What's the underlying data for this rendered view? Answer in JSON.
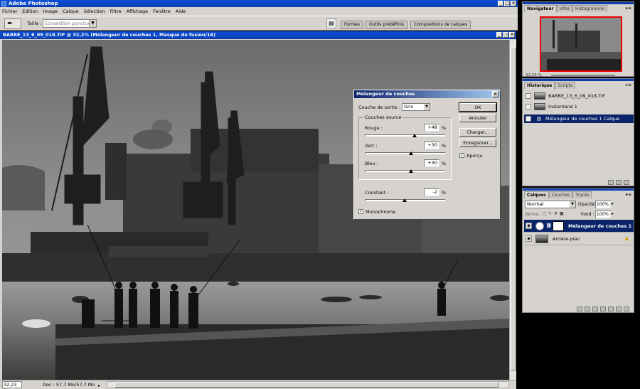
{
  "app": {
    "title": "Adobe Photoshop",
    "window_buttons": [
      "_",
      "□",
      "×"
    ]
  },
  "menu": [
    "Fichier",
    "Edition",
    "Image",
    "Calque",
    "Sélection",
    "Filtre",
    "Affichage",
    "Fenêtre",
    "Aide"
  ],
  "options_bar": {
    "size_label": "Taille :",
    "sample_value": "Echantillon ponctuel",
    "well_tabs": [
      "Formes",
      "Outils prédéfinis",
      "Compositions de calques"
    ]
  },
  "document": {
    "title": "BARRE_13_6_09_018.TIF @ 32,2% (Mélangeur de couches 1, Masque de fusion/16)",
    "zoom": "32,23 %",
    "doc_info": "Doc : 57,7 Mo/57,7 Mo",
    "status_arrow": "▸"
  },
  "mixer": {
    "title": "Mélangeur de couches",
    "output_label": "Couche de sortie :",
    "output_value": "Gris",
    "source_group": "Couches source",
    "red_label": "Rouge :",
    "red_value": "+48",
    "red_level": 48,
    "green_label": "Vert :",
    "green_value": "+30",
    "green_level": 30,
    "blue_label": "Bleu :",
    "blue_value": "+30",
    "blue_level": 30,
    "constant_label": "Constant :",
    "constant_value": "-2",
    "constant_level": -2,
    "percent": "%",
    "monochrome_label": "Monochrome",
    "monochrome_checked": true,
    "ok": "OK",
    "cancel": "Annuler",
    "load": "Charger...",
    "save": "Enregistrer...",
    "preview_label": "Aperçu",
    "preview_checked": true,
    "close": "×"
  },
  "navigator": {
    "tabs": [
      "Navigateur",
      "Infos",
      "Histogramme"
    ],
    "zoom": "32,23 %"
  },
  "history": {
    "tabs": [
      "Historique",
      "Scripts"
    ],
    "items": [
      {
        "label": "BARRE_13_6_09_018.TIF"
      },
      {
        "label": "Instantané 1"
      },
      {
        "label": "Mélangeur de couches 1 Calque"
      }
    ]
  },
  "layers": {
    "tabs": [
      "Calques",
      "Couches",
      "Tracés"
    ],
    "blend_mode": "Normal",
    "opacity_label": "Opacité:",
    "opacity_value": "100%",
    "lock_label": "Verrou :",
    "fill_label": "Fond :",
    "fill_value": "100%",
    "items": [
      {
        "label": "Mélangeur de couches 1"
      },
      {
        "label": "Arrière-plan"
      }
    ]
  },
  "palette_menu": "▸≡"
}
